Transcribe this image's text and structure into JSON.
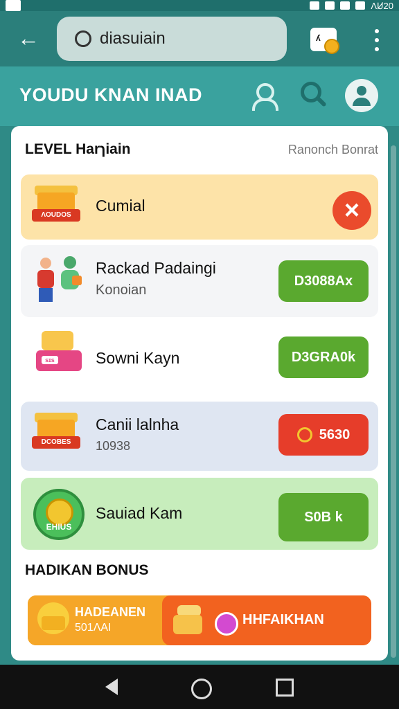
{
  "status": {
    "time": "ɅꞸ20"
  },
  "toolbar": {
    "search_value": "diasuiain",
    "badge_text": "ʎ"
  },
  "header": {
    "title": "YOUDU KNAN INAD"
  },
  "panel": {
    "title": "LEVEL Harɿiain",
    "right_text": "Ranonch Bonrat"
  },
  "rows": [
    {
      "title": "Cumial",
      "icon_label": "ɅOUDOS"
    },
    {
      "title": "Rackad Padaingi",
      "subtitle": "Konoian",
      "button": "D3088Ax"
    },
    {
      "title": "Sowni Kayn",
      "button": "D3GRA0k",
      "box_tag": "sɪs"
    },
    {
      "title": "Canii lalnha",
      "subtitle": "10938",
      "button": "5630",
      "icon_label": "DCOBES"
    },
    {
      "title": "Sauiad Kam",
      "button": "S0B k",
      "icon_label": "EHIUS"
    }
  ],
  "section": {
    "title": "HADIKAN BONUS"
  },
  "bonus": {
    "left_title": "HADEANEN",
    "left_sub": "501ɅAI",
    "right_title": "HHFAIKHAN"
  },
  "colors": {
    "toolbar": "#2b7f7b",
    "header": "#3aa29e",
    "primary_green": "#5aa92f",
    "accent_red": "#e63d2a",
    "bonus_orange": "#f2621f"
  },
  "icons": {
    "back": "arrow-left-icon",
    "search": "search-icon",
    "user": "user-icon",
    "avatar": "avatar-icon",
    "more": "more-vert-icon",
    "close": "close-icon",
    "coin": "coin-icon",
    "gift": "gift-icon",
    "treasure": "treasure-icon",
    "gem": "gem-icon"
  }
}
